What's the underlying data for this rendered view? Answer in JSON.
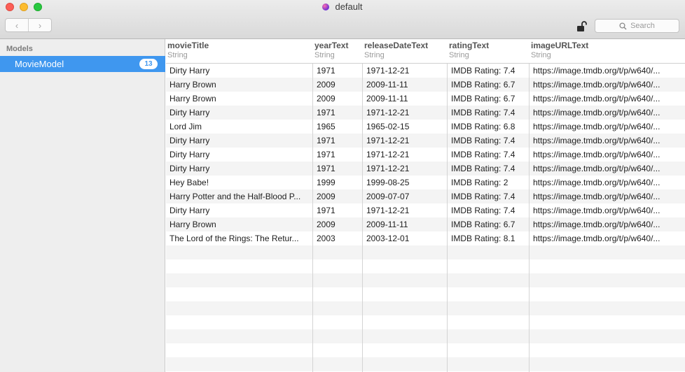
{
  "window": {
    "title": "default"
  },
  "toolbar": {
    "back_glyph": "‹",
    "forward_glyph": "›",
    "search_placeholder": "Search"
  },
  "sidebar": {
    "section_label": "Models",
    "items": [
      {
        "label": "MovieModel",
        "count": "13"
      }
    ]
  },
  "table": {
    "columns": [
      {
        "name": "movieTitle",
        "type": "String"
      },
      {
        "name": "yearText",
        "type": "String"
      },
      {
        "name": "releaseDateText",
        "type": "String"
      },
      {
        "name": "ratingText",
        "type": "String"
      },
      {
        "name": "imageURLText",
        "type": "String"
      }
    ],
    "rows": [
      [
        "Dirty Harry",
        "1971",
        "1971-12-21",
        "IMDB Rating: 7.4",
        "https://image.tmdb.org/t/p/w640/..."
      ],
      [
        "Harry Brown",
        "2009",
        "2009-11-11",
        "IMDB Rating: 6.7",
        "https://image.tmdb.org/t/p/w640/..."
      ],
      [
        "Harry Brown",
        "2009",
        "2009-11-11",
        "IMDB Rating: 6.7",
        "https://image.tmdb.org/t/p/w640/..."
      ],
      [
        "Dirty Harry",
        "1971",
        "1971-12-21",
        "IMDB Rating: 7.4",
        "https://image.tmdb.org/t/p/w640/..."
      ],
      [
        "Lord Jim",
        "1965",
        "1965-02-15",
        "IMDB Rating: 6.8",
        "https://image.tmdb.org/t/p/w640/..."
      ],
      [
        "Dirty Harry",
        "1971",
        "1971-12-21",
        "IMDB Rating: 7.4",
        "https://image.tmdb.org/t/p/w640/..."
      ],
      [
        "Dirty Harry",
        "1971",
        "1971-12-21",
        "IMDB Rating: 7.4",
        "https://image.tmdb.org/t/p/w640/..."
      ],
      [
        "Dirty Harry",
        "1971",
        "1971-12-21",
        "IMDB Rating: 7.4",
        "https://image.tmdb.org/t/p/w640/..."
      ],
      [
        "Hey Babe!",
        "1999",
        "1999-08-25",
        "IMDB Rating: 2",
        "https://image.tmdb.org/t/p/w640/..."
      ],
      [
        "Harry Potter and the Half-Blood P...",
        "2009",
        "2009-07-07",
        "IMDB Rating: 7.4",
        "https://image.tmdb.org/t/p/w640/..."
      ],
      [
        "Dirty Harry",
        "1971",
        "1971-12-21",
        "IMDB Rating: 7.4",
        "https://image.tmdb.org/t/p/w640/..."
      ],
      [
        "Harry Brown",
        "2009",
        "2009-11-11",
        "IMDB Rating: 6.7",
        "https://image.tmdb.org/t/p/w640/..."
      ],
      [
        "The Lord of the Rings: The Retur...",
        "2003",
        "2003-12-01",
        "IMDB Rating: 8.1",
        "https://image.tmdb.org/t/p/w640/..."
      ]
    ]
  },
  "colors": {
    "selection": "#3f97ef",
    "sidebar_bg": "#eeeeee",
    "row_alt": "#f4f4f4",
    "close": "#fc5f57",
    "minimize": "#fdbc2e",
    "zoom": "#28c840"
  },
  "icons": [
    "close-icon",
    "minimize-icon",
    "zoom-icon",
    "document-icon",
    "back-icon",
    "forward-icon",
    "unlock-icon",
    "search-icon"
  ]
}
